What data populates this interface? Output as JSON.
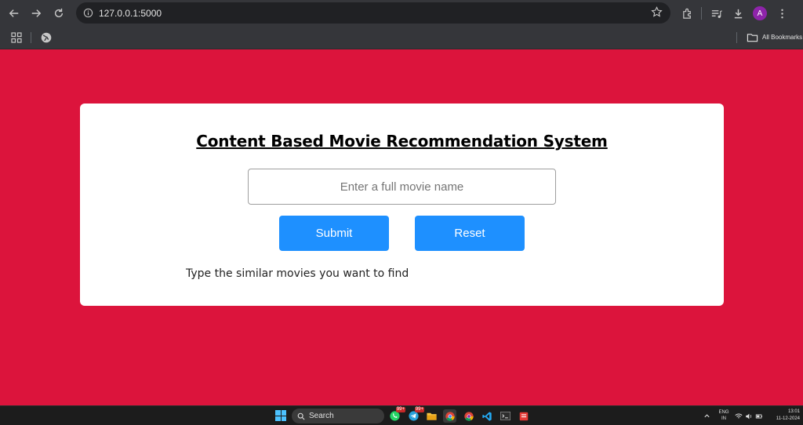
{
  "browser": {
    "url": "127.0.0.1:5000",
    "avatar_initial": "A",
    "bookmarks_label": "All Bookmarks"
  },
  "page": {
    "title": "Content Based Movie Recommendation System",
    "input": {
      "placeholder": "Enter a full movie name",
      "value": ""
    },
    "submit_label": "Submit",
    "reset_label": "Reset",
    "hint": "Type the similar movies you want to find"
  },
  "colors": {
    "page_background": "#dc143c",
    "button": "#1e90ff",
    "card": "#ffffff"
  },
  "taskbar": {
    "search_label": "Search",
    "badge_count": "99+",
    "language_line1": "ENG",
    "language_line2": "IN",
    "time": "13:01",
    "date": "11-12-2024"
  }
}
